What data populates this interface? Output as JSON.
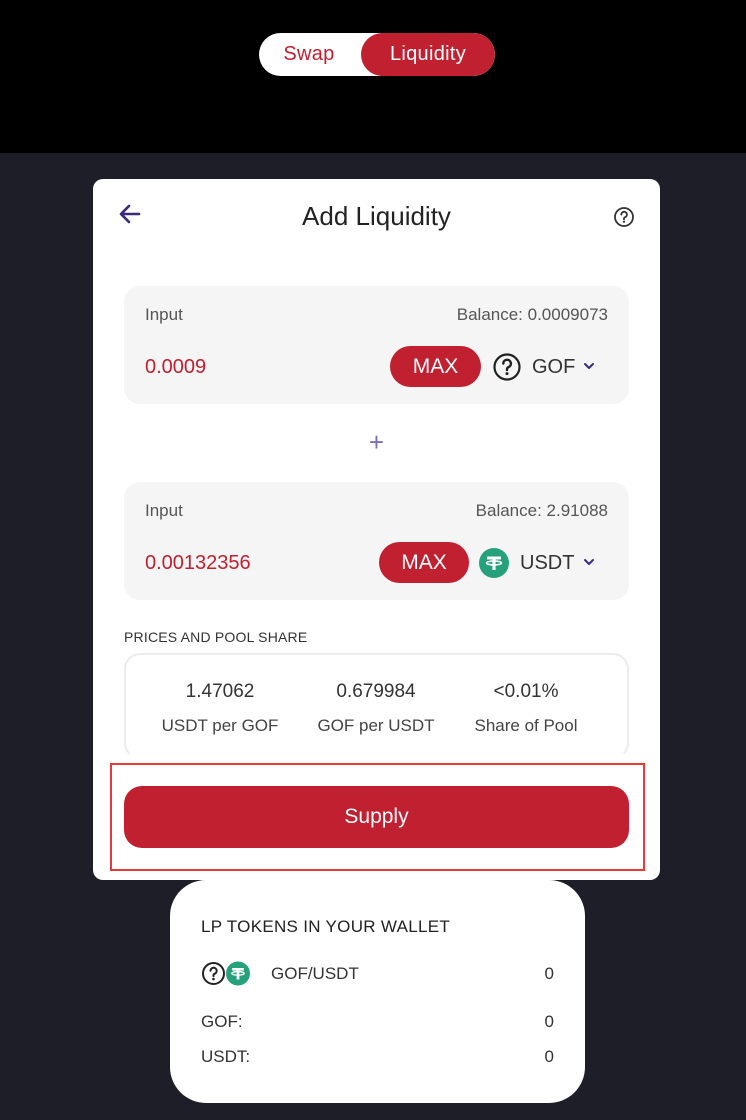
{
  "top_tabs": {
    "swap": "Swap",
    "liquidity": "Liquidity"
  },
  "card": {
    "title": "Add Liquidity",
    "back_icon": "arrow-left-icon",
    "help_icon": "question-circle-icon"
  },
  "input1": {
    "label": "Input",
    "balance": "Balance: 0.0009073",
    "amount": "0.0009",
    "max_label": "MAX",
    "token_icon": "question-circle-icon",
    "token": "GOF"
  },
  "plus": "+",
  "input2": {
    "label": "Input",
    "balance": "Balance: 2.91088",
    "amount": "0.00132356",
    "max_label": "MAX",
    "token_icon": "tether-icon",
    "token": "USDT"
  },
  "prices": {
    "section_label": "PRICES AND POOL SHARE",
    "items": [
      {
        "value": "1.47062",
        "label": "USDT per GOF"
      },
      {
        "value": "0.679984",
        "label": "GOF per USDT"
      },
      {
        "value": "<0.01%",
        "label": "Share of Pool"
      }
    ]
  },
  "supply_label": "Supply",
  "lp": {
    "title": "LP TOKENS IN YOUR WALLET",
    "pair": "GOF/USDT",
    "pair_value": "0",
    "rows": [
      {
        "label": "GOF:",
        "value": "0"
      },
      {
        "label": "USDT:",
        "value": "0"
      }
    ]
  },
  "colors": {
    "accent": "#c0202f",
    "page_bg": "#1e1e28",
    "highlight": "#e53a36",
    "tether": "#26a17b"
  }
}
